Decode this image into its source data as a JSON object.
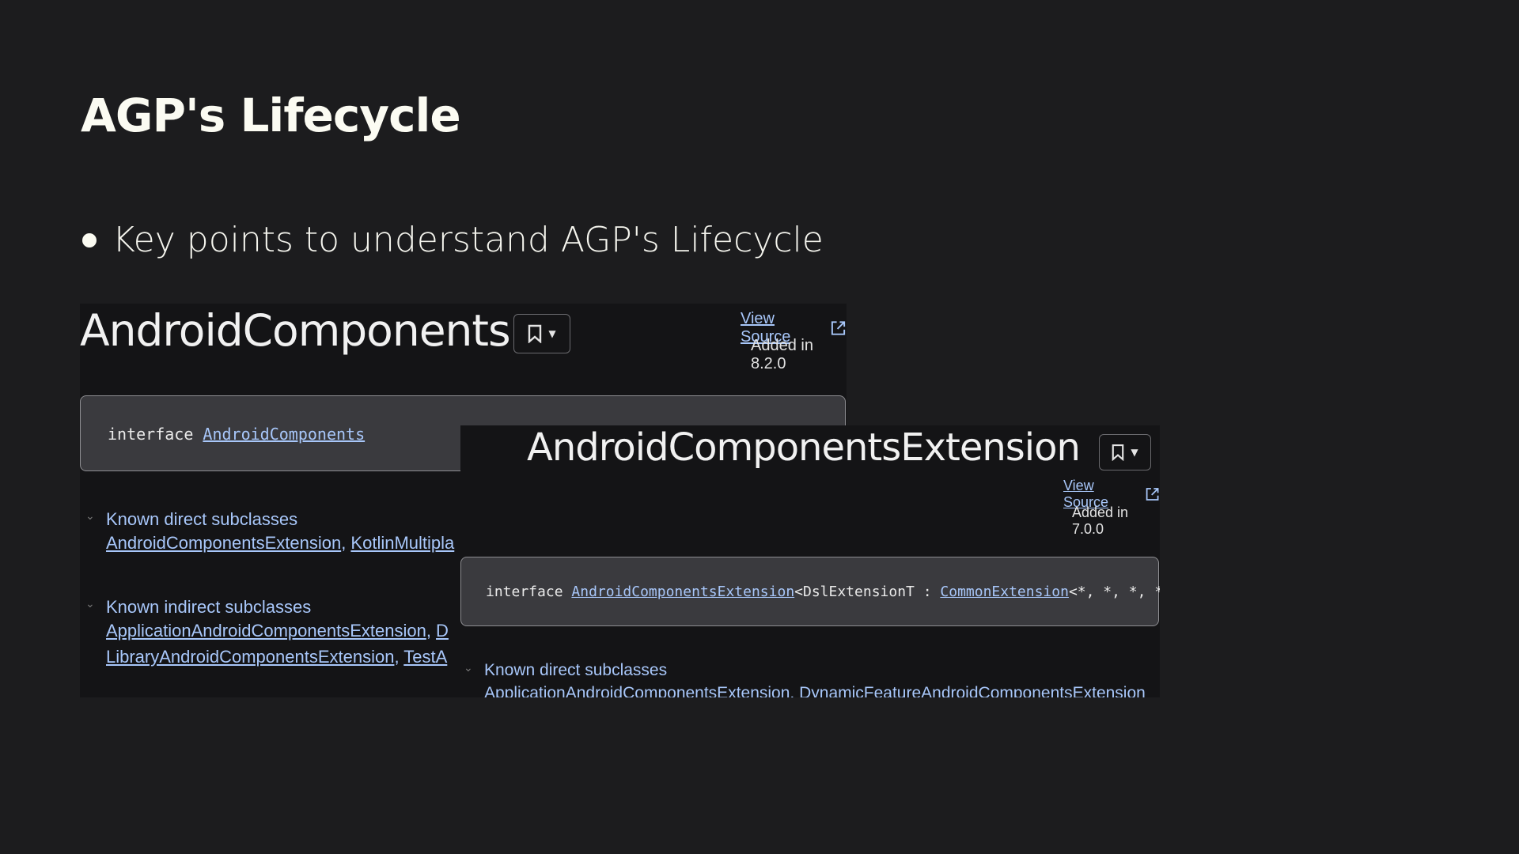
{
  "slide": {
    "title": "AGP's Lifecycle",
    "bullet": "Key points to understand AGP's Lifecycle"
  },
  "panel_primary": {
    "title": "AndroidComponents",
    "view_source": "View Source",
    "added": "Added in 8.2.0",
    "signature_keyword": "interface",
    "signature_link": "AndroidComponents",
    "direct_header": "Known direct subclasses",
    "direct_links": [
      "AndroidComponentsExtension",
      "KotlinMultipla"
    ],
    "indirect_header": "Known indirect subclasses",
    "indirect_line1": [
      "ApplicationAndroidComponentsExtension",
      "D"
    ],
    "indirect_line2": [
      "LibraryAndroidComponentsExtension",
      "TestA"
    ]
  },
  "panel_extension": {
    "title": "AndroidComponentsExtension",
    "view_source": "View Source",
    "added": "Added in 7.0.0",
    "signature_keyword": "interface",
    "signature_link": "AndroidComponentsExtension",
    "signature_mid": "<DslExtensionT : ",
    "signature_link2": "CommonExtension",
    "signature_tail": "<*, *, *, *,",
    "direct_header": "Known direct subclasses",
    "direct_links": [
      "ApplicationAndroidComponentsExtension",
      "DynamicFeatureAndroidComponentsExtension"
    ]
  },
  "icons": {
    "bookmark": "bookmark-icon",
    "dropdown": "caret-down-icon",
    "external": "open-in-new-icon",
    "chevron": "chevron-down-icon"
  },
  "colors": {
    "background": "#1c1c1e",
    "link": "#a8c7fa",
    "signature_box": "#3a3a3e"
  }
}
